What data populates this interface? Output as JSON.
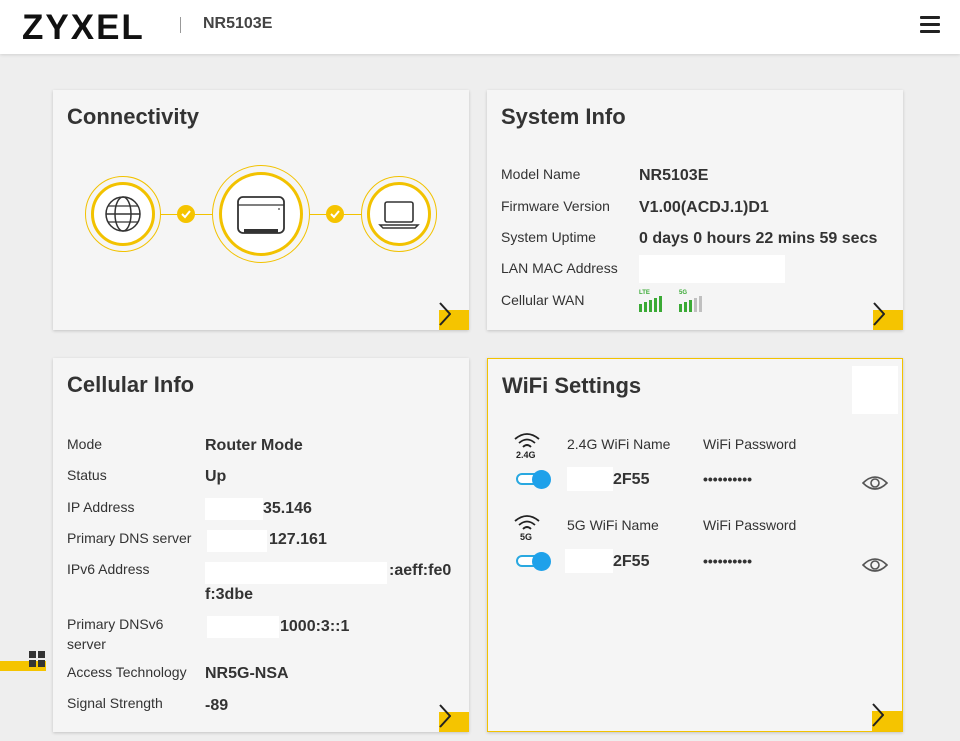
{
  "header": {
    "brand": "ZYXEL",
    "model": "NR5103E",
    "icons": {
      "menu": "hamburger-menu-icon"
    }
  },
  "connectivity": {
    "title": "Connectivity",
    "nodes": [
      "globe-icon",
      "router-icon",
      "laptop-icon"
    ],
    "links": [
      "check-icon",
      "check-icon"
    ],
    "accent": "#f5c400"
  },
  "system_info": {
    "title": "System Info",
    "rows": [
      {
        "label": "Model Name",
        "value": "NR5103E"
      },
      {
        "label": "Firmware Version",
        "value": "V1.00(ACDJ.1)D1"
      },
      {
        "label": "System Uptime",
        "value": "0 days 0 hours 22 mins 59 secs"
      },
      {
        "label": "LAN MAC Address",
        "value": ""
      },
      {
        "label": "Cellular WAN",
        "value": ""
      }
    ],
    "signals": [
      {
        "tag": "LTE",
        "bars": 5,
        "active": 5,
        "color": "#3aaa35"
      },
      {
        "tag": "5G",
        "bars": 5,
        "active": 3,
        "color": "#3aaa35"
      }
    ]
  },
  "cellular_info": {
    "title": "Cellular Info",
    "rows": [
      {
        "label": "Mode",
        "value": "Router Mode"
      },
      {
        "label": "Status",
        "value": "Up"
      },
      {
        "label": "IP Address",
        "value": "35.146"
      },
      {
        "label": "Primary DNS server",
        "value": "127.161"
      },
      {
        "label": "IPv6 Address",
        "value": ":aeff:fe0",
        "value2": "f:3dbe"
      },
      {
        "label": "Primary DNSv6",
        "label2": "server",
        "value": "1000:3::1"
      },
      {
        "label": "Access Technology",
        "value": "NR5G-NSA"
      },
      {
        "label": "Signal Strength",
        "value": "-89"
      }
    ]
  },
  "wifi_settings": {
    "title": "WiFi Settings",
    "bands": [
      {
        "badge": "2.4G",
        "name_label": "2.4G WiFi Name",
        "pw_label": "WiFi Password",
        "ssid": "2F55",
        "password": "••••••••••",
        "enabled": true
      },
      {
        "badge": "5G",
        "name_label": "5G WiFi Name",
        "pw_label": "WiFi Password",
        "ssid": "2F55",
        "password": "••••••••••",
        "enabled": true
      }
    ],
    "toggle_color": "#1ea1ea"
  },
  "side": {
    "icons": {
      "widgets": "grid-icon"
    }
  }
}
